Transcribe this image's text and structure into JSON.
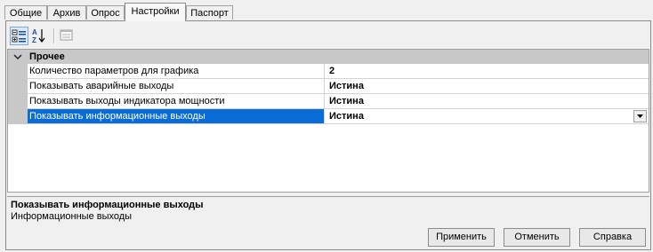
{
  "tabs": [
    {
      "label": "Общие"
    },
    {
      "label": "Архив"
    },
    {
      "label": "Опрос"
    },
    {
      "label": "Настройки",
      "active": true
    },
    {
      "label": "Паспорт"
    }
  ],
  "toolbar": {
    "icons": [
      "categorized-sort-icon",
      "alphabetical-sort-icon",
      "property-pages-icon"
    ]
  },
  "grid": {
    "category": "Прочее",
    "properties": [
      {
        "name": "Количество параметров для графика",
        "value": "2"
      },
      {
        "name": "Показывать аварийные выходы",
        "value": "Истина"
      },
      {
        "name": "Показывать выходы индикатора мощности",
        "value": "Истина"
      },
      {
        "name": "Показывать информационные выходы",
        "value": "Истина",
        "selected": true
      }
    ]
  },
  "description": {
    "title": "Показывать информационные выходы",
    "text": "Информационные выходы"
  },
  "buttons": {
    "apply": "Применить",
    "cancel": "Отменить",
    "help": "Справка"
  },
  "colors": {
    "selection": "#0a6cd6",
    "category_bg": "#c8c8c8"
  }
}
